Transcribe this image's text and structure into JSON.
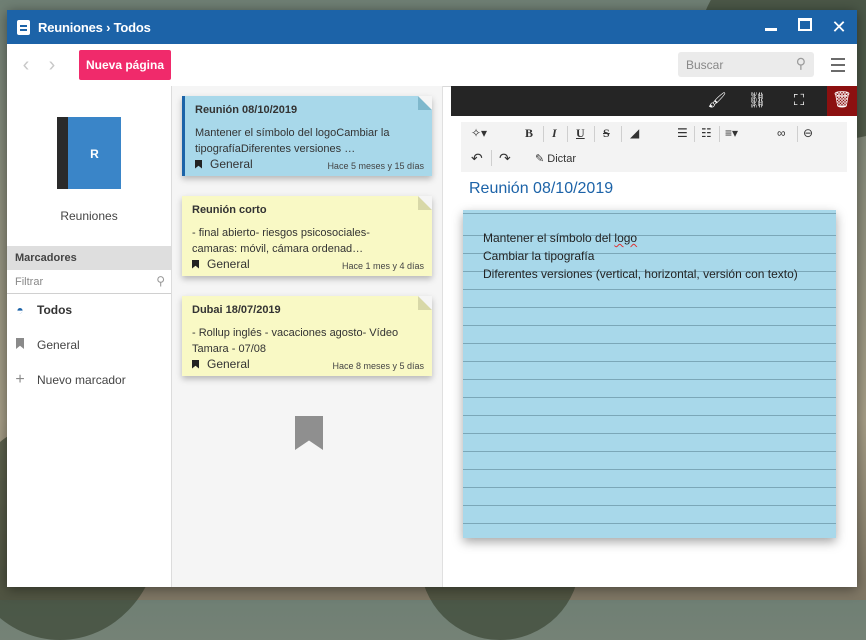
{
  "window": {
    "title": "Reuniones › Todos",
    "controls": [
      "minimize",
      "maximize",
      "close"
    ]
  },
  "toolbar": {
    "new_page_label": "Nueva página",
    "search_placeholder": "Buscar"
  },
  "sidebar": {
    "notebook_letter": "R",
    "notebook_name": "Reuniones",
    "bookmarks_header": "Marcadores",
    "filter_placeholder": "Filtrar",
    "items": [
      {
        "label": "Todos",
        "icon": "inbox-icon",
        "active": true
      },
      {
        "label": "General",
        "icon": "bookmark-icon",
        "active": false
      },
      {
        "label": "Nuevo marcador",
        "icon": "plus-icon",
        "active": false
      }
    ]
  },
  "notes": [
    {
      "title": "Reunión 08/10/2019",
      "preview": "Mantener el símbolo del logoCambiar la tipografíaDiferentes versiones …",
      "tag": "General",
      "time": "Hace 5 meses y 15 días",
      "selected": true
    },
    {
      "title": "Reunión corto",
      "preview": "- final abierto- riesgos psicosociales- camaras: móvil, cámara ordenad…",
      "tag": "General",
      "time": "Hace 1 mes y 4 días",
      "selected": false
    },
    {
      "title": "Dubai 18/07/2019",
      "preview": "- Rollup inglés - vacaciones agosto- Vídeo Tamara - 07/08",
      "tag": "General",
      "time": "Hace 8 meses y 5 días",
      "selected": false
    }
  ],
  "editor": {
    "dictate_label": "Dictar",
    "note_title": "Reunión 08/10/2019",
    "lines": [
      {
        "before": "Mantener el símbolo del ",
        "misspelled": "logo"
      },
      {
        "text": "Cambiar la tipografía"
      },
      {
        "text": "Diferentes versiones (vertical, horizontal, versión con texto)"
      }
    ]
  },
  "colors": {
    "titlebar": "#1c63a8",
    "accent_pink": "#f02a6b",
    "note_blue": "#a8d8ea",
    "note_yellow": "#f9f9c5",
    "delete_red": "#8c1010"
  }
}
